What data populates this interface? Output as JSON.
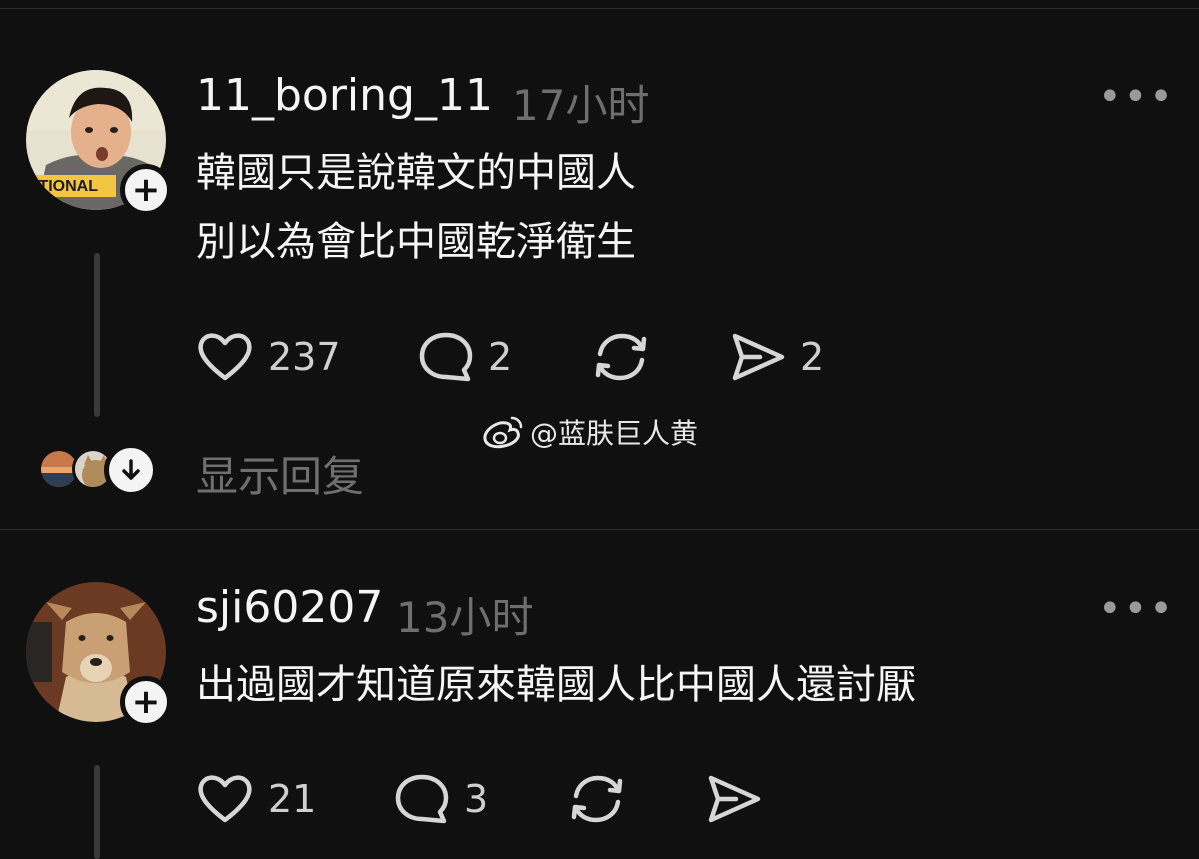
{
  "posts": [
    {
      "username": "11_boring_11",
      "time": "17小时",
      "more": "•••",
      "lines": [
        "韓國只是說韓文的中國人",
        "別以為會比中國乾淨衛生"
      ],
      "avatar_text": "OTIONAL",
      "likes": "237",
      "comments": "2",
      "shares": "2",
      "show_replies": "显示回复"
    },
    {
      "username": "sji60207",
      "time": "13小时",
      "more": "•••",
      "lines": [
        "出過國才知道原來韓國人比中國人還討厭"
      ],
      "likes": "21",
      "comments": "3"
    }
  ],
  "watermark": "@蓝肤巨人黄",
  "icons": {
    "like": "heart-icon",
    "comment": "speech-bubble-icon",
    "repost": "repost-icon",
    "share": "send-icon",
    "follow": "plus-icon",
    "expand": "arrow-down-icon",
    "weibo": "weibo-icon",
    "menu": "more-icon"
  },
  "colors": {
    "background": "#101010",
    "text": "#f5f5f5",
    "muted": "#6e6e6e",
    "divider": "#2d2d2d"
  }
}
